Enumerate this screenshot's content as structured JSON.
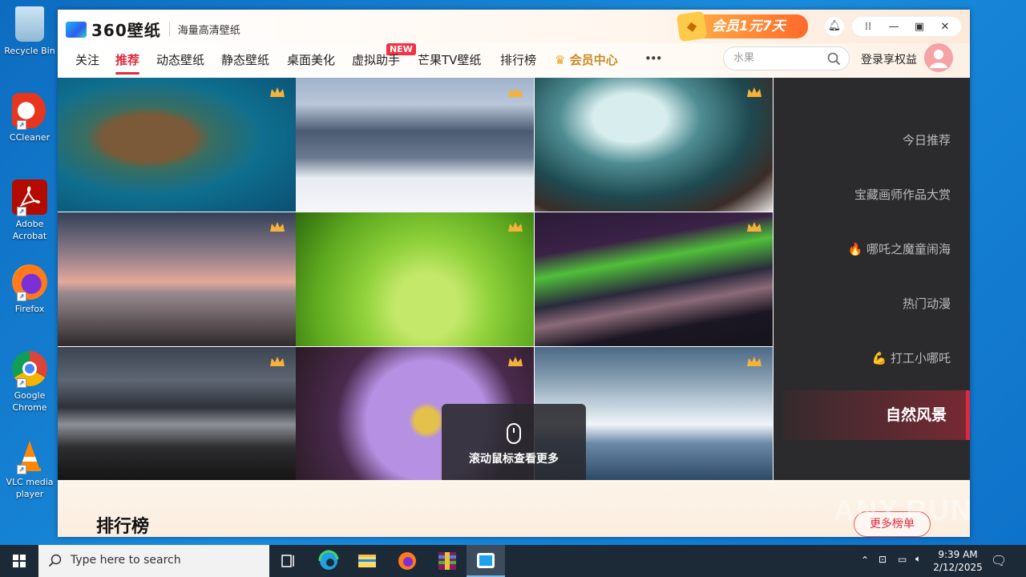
{
  "desktop": {
    "icons": [
      {
        "label": "Recycle Bin"
      },
      {
        "label": "CCleaner"
      },
      {
        "label": "Adobe Acrobat"
      },
      {
        "label": "Firefox"
      },
      {
        "label": "Google Chrome"
      },
      {
        "label": "VLC media player"
      }
    ]
  },
  "app": {
    "logo_text": "360壁纸",
    "subtitle": "海量高清壁纸",
    "vip_banner": "会员1元7天",
    "nav": {
      "items": [
        "关注",
        "推荐",
        "动态壁纸",
        "静态壁纸",
        "桌面美化",
        "虚拟助手",
        "芒果TV壁纸",
        "排行榜",
        "会员中心",
        "•••"
      ],
      "new_badge": "NEW",
      "active": "推荐"
    },
    "search": {
      "placeholder": "水果"
    },
    "login_label": "登录享权益",
    "categories": [
      "今日推荐",
      "宝藏画师作品大赏",
      "🔥 哪吒之魔童闹海",
      "热门动漫",
      "💪 打工小哪吒",
      "自然风景"
    ],
    "active_category": "自然风景",
    "scroll_hint": "滚动鼠标查看更多",
    "ranking_title": "排行榜",
    "more_button": "更多榜单"
  },
  "watermark": "ANY.RUN",
  "taskbar": {
    "search_placeholder": "Type here to search",
    "time": "9:39 AM",
    "date": "2/12/2025"
  },
  "colors": {
    "accent": "#e02b3c",
    "vip_gold": "#c98b25",
    "panel_bg": "#2b2b2e"
  }
}
